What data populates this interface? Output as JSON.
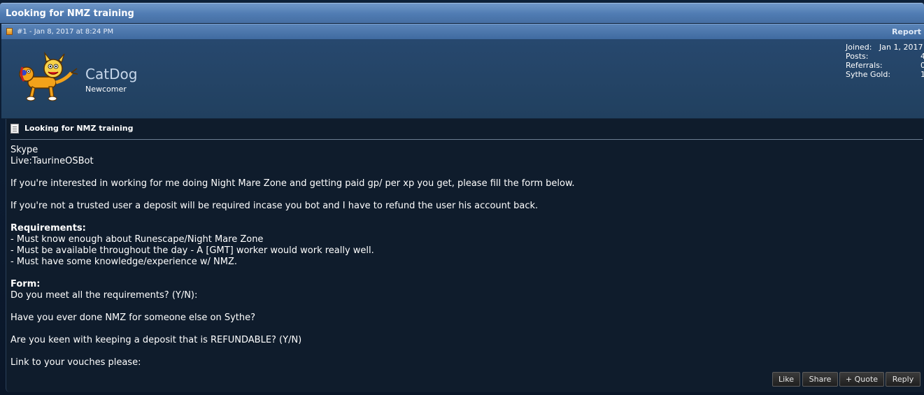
{
  "thread": {
    "title": "Looking for NMZ training"
  },
  "post": {
    "meta": "#1 - Jan 8, 2017 at 8:24 PM",
    "report_label": "Report",
    "title": "Looking for NMZ training"
  },
  "user": {
    "name": "CatDog",
    "title": "Newcomer",
    "stats": [
      {
        "label": "Joined:",
        "value": "Jan 1, 2017"
      },
      {
        "label": "Posts:",
        "value": "4"
      },
      {
        "label": "Referrals:",
        "value": "0"
      },
      {
        "label": "Sythe Gold:",
        "value": "1"
      }
    ]
  },
  "message": {
    "lines": [
      "Skype",
      "Live:TaurineOSBot",
      "",
      "If you're interested in working for me doing Night Mare Zone and getting paid gp/ per xp you get, please fill the form below.",
      "",
      "If you're not a trusted user a deposit will be required incase you bot and I have to refund the user his account back.",
      "",
      "Requirements:",
      "- Must know enough about Runescape/Night Mare Zone",
      "- Must be available throughout the day - A [GMT] worker would work really well.",
      "- Must have some knowledge/experience w/ NMZ.",
      "",
      "Form:",
      "Do you meet all the requirements? (Y/N):",
      "",
      "Have you ever done NMZ for someone else on Sythe?",
      "",
      "Are you keen with keeping a deposit that is REFUNDABLE? (Y/N)",
      "",
      "Link to your vouches please:"
    ]
  },
  "actions": {
    "like": "Like",
    "share": "Share",
    "quote": "+ Quote",
    "reply": "Reply"
  },
  "colors": {
    "title_bar": "#5a84b8",
    "user_panel": "#244466",
    "post_body": "#0f1c2c"
  }
}
